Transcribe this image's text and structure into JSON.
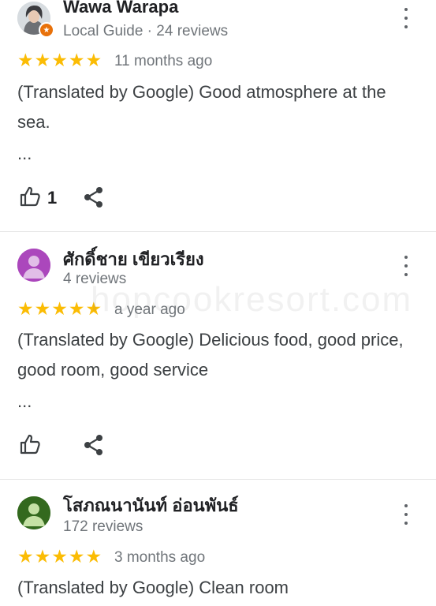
{
  "reviews": [
    {
      "name": "Wawa Warapa",
      "meta": "Local Guide · 24 reviews",
      "rating": 5,
      "time": "11 months ago",
      "text": "(Translated by Google) Good atmosphere at the sea.",
      "more": "...",
      "likes": "1",
      "avatar_color": "#cfd8dc",
      "local_guide": true
    },
    {
      "name": "ศักดิ์ชาย เขียวเรียง",
      "meta": "4 reviews",
      "rating": 5,
      "time": "a year ago",
      "text": "(Translated by Google) Delicious food, good price, good room, good service",
      "more": "...",
      "likes": "",
      "avatar_color": "#ab47bc"
    },
    {
      "name": "โสภณนานันท์ อ่อนพันธ์",
      "meta": "172 reviews",
      "rating": 5,
      "time": "3 months ago",
      "text": "(Translated by Google) Clean room",
      "avatar_color": "#33691e"
    }
  ],
  "watermark": "hopcookresort.com",
  "colors": {
    "star": "#fbbc04",
    "secondary_text": "#70757a",
    "badge": "#e8710a"
  },
  "icons": {
    "menu": "more-vertical-icon",
    "like": "thumb-up-icon",
    "share": "share-icon"
  }
}
